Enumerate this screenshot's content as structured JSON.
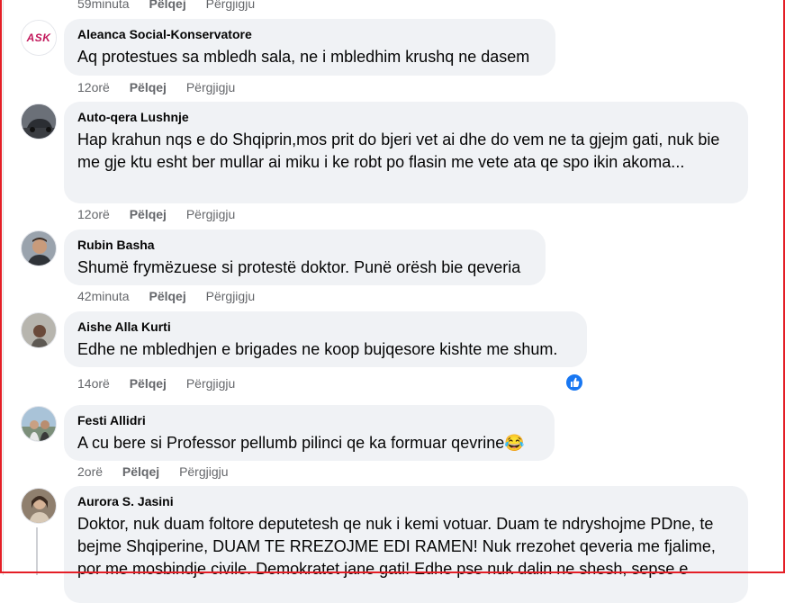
{
  "top_meta": {
    "time": "59minuta",
    "like": "Pëlqej",
    "reply": "Përgjigju"
  },
  "comments": [
    {
      "author": "Aleanca Social-Konservatore",
      "text": "Aq protestues sa mbledh sala, ne i mbledhim krushq ne dasem",
      "time": "12orë",
      "like": "Pëlqej",
      "reply": "Përgjigju",
      "avatar_text": "ASK"
    },
    {
      "author": "Auto-qera Lushnje",
      "text": "Hap krahun nqs e do Shqiprin,mos prit do bjeri vet ai dhe do vem ne ta gjejm gati, nuk bie me gje ktu esht ber mullar ai miku i ke robt po flasin me vete ata qe spo ikin akoma...",
      "time": "12orë",
      "like": "Pëlqej",
      "reply": "Përgjigju"
    },
    {
      "author": "Rubin Basha",
      "text": "Shumë frymëzuese si protestë doktor. Punë orësh bie qeveria",
      "time": "42minuta",
      "like": "Pëlqej",
      "reply": "Përgjigju"
    },
    {
      "author": "Aishe Alla Kurti",
      "text": "Edhe ne mbledhjen e brigades ne koop bujqesore kishte me shum.",
      "time": "14orë",
      "like": "Pëlqej",
      "reply": "Përgjigju"
    },
    {
      "author": "Festi Allidri",
      "text": "A cu bere si Professor pellumb pilinci qe ka formuar qevrine",
      "emoji": "😂",
      "time": "2orë",
      "like": "Pëlqej",
      "reply": "Përgjigju"
    },
    {
      "author": "Aurora S. Jasini",
      "text": "Doktor, nuk duam foltore deputetesh qe nuk i kemi votuar. Duam te ndryshojme PDne, te bejme Shqiperine, DUAM TE RREZOJME EDI RAMEN! Nuk rrezohet qeveria me fjalime, por me mosbindje civile. Demokratet jane gati! Edhe pse nuk dalin ne shesh, sepse e"
    }
  ],
  "colors": {
    "bubble": "#f0f2f5",
    "meta": "#65676b",
    "like_badge": "#1877f2",
    "frame": "#e41e26"
  }
}
